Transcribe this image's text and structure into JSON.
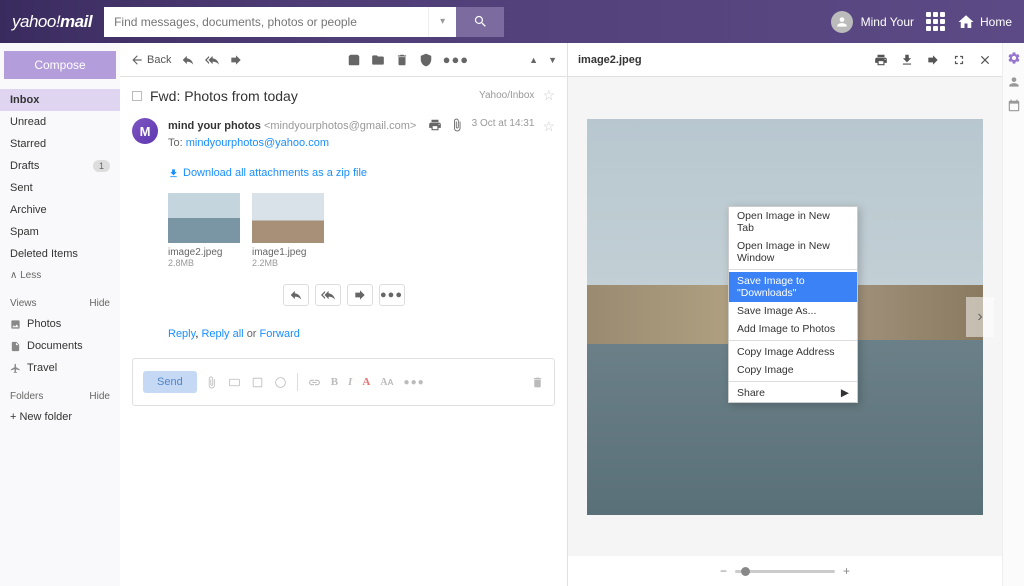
{
  "header": {
    "logo_prefix": "yahoo!",
    "logo_suffix": "mail",
    "search_placeholder": "Find messages, documents, photos or people",
    "username": "Mind Your",
    "home_label": "Home"
  },
  "sidebar": {
    "compose_label": "Compose",
    "folders": [
      {
        "label": "Inbox",
        "active": true
      },
      {
        "label": "Unread"
      },
      {
        "label": "Starred"
      },
      {
        "label": "Drafts",
        "badge": "1"
      },
      {
        "label": "Sent"
      },
      {
        "label": "Archive"
      },
      {
        "label": "Spam"
      },
      {
        "label": "Deleted Items"
      }
    ],
    "less_label": "Less",
    "views_header": "Views",
    "hide_label": "Hide",
    "views": [
      {
        "label": "Photos"
      },
      {
        "label": "Documents"
      },
      {
        "label": "Travel"
      }
    ],
    "folders_header": "Folders",
    "new_folder_label": "New folder"
  },
  "message": {
    "back_label": "Back",
    "subject": "Fwd: Photos from today",
    "location": "Yahoo/Inbox",
    "from_name": "mind your photos",
    "from_addr": "<mindyourphotos@gmail.com>",
    "to_label": "To:",
    "to_addr": "mindyourphotos@yahoo.com",
    "date": "3 Oct at 14:31",
    "download_all": "Download all attachments as a zip file",
    "attachments": [
      {
        "filename": "image2.jpeg",
        "size": "2.8MB"
      },
      {
        "filename": "image1.jpeg",
        "size": "2.2MB"
      }
    ],
    "reply_label": "Reply",
    "reply_all_label": "Reply all",
    "or_label": "or",
    "forward_label": "Forward",
    "send_label": "Send"
  },
  "preview": {
    "filename": "image2.jpeg"
  },
  "context_menu": {
    "items": [
      {
        "label": "Open Image in New Tab"
      },
      {
        "label": "Open Image in New Window"
      },
      {
        "sep": true
      },
      {
        "label": "Save Image to \"Downloads\"",
        "selected": true
      },
      {
        "label": "Save Image As..."
      },
      {
        "label": "Add Image to Photos"
      },
      {
        "sep": true
      },
      {
        "label": "Copy Image Address"
      },
      {
        "label": "Copy Image"
      },
      {
        "sep": true
      },
      {
        "label": "Share",
        "submenu": true
      }
    ]
  }
}
